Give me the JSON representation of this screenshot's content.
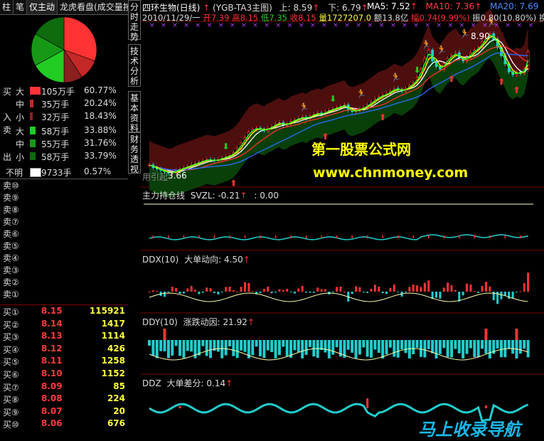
{
  "tabs": [
    {
      "label": "柱",
      "active": false
    },
    {
      "label": "笔",
      "active": false
    },
    {
      "label": "仅主动",
      "active": true
    },
    {
      "label": "龙虎看盘(成交量按",
      "active": false
    }
  ],
  "pie": {
    "slices": [
      {
        "name": "大买",
        "value": 60.77,
        "color": "#ff3333"
      },
      {
        "name": "中买",
        "value": 20.24,
        "color": "#c42828"
      },
      {
        "name": "小买",
        "value": 18.43,
        "color": "#8a2020"
      },
      {
        "name": "大卖",
        "value": 33.88,
        "color": "#22cc22"
      },
      {
        "name": "中卖",
        "value": 31.76,
        "color": "#179917"
      },
      {
        "name": "小卖",
        "value": 33.79,
        "color": "#0e6b0e"
      }
    ]
  },
  "flow": {
    "buy_side": [
      "买",
      "入"
    ],
    "sell_side": [
      "卖",
      "出"
    ],
    "rows": [
      {
        "size": "大",
        "volume": "105万手",
        "pct": "60.77%",
        "bar": 0.6077,
        "color": "#ff3333"
      },
      {
        "size": "中",
        "volume": "35万手",
        "pct": "20.24%",
        "bar": 0.2024,
        "color": "#c42828"
      },
      {
        "size": "小",
        "volume": "32万手",
        "pct": "18.43%",
        "bar": 0.1843,
        "color": "#8a2020"
      },
      {
        "size": "大",
        "volume": "58万手",
        "pct": "33.88%",
        "bar": 0.3388,
        "color": "#22cc22"
      },
      {
        "size": "中",
        "volume": "55万手",
        "pct": "31.76%",
        "bar": 0.3176,
        "color": "#179917"
      },
      {
        "size": "小",
        "volume": "58万手",
        "pct": "33.79%",
        "bar": 0.3379,
        "color": "#0e6b0e"
      }
    ],
    "unknown": {
      "label": "不明",
      "volume": "9733手",
      "pct": "0.57%",
      "bar": 0.0057,
      "color": "#ffffff"
    }
  },
  "orderbook": {
    "sells": [
      "卖⑩",
      "卖⑨",
      "卖⑧",
      "卖⑦",
      "卖⑥",
      "卖⑤",
      "卖④",
      "卖③",
      "卖②",
      "卖①"
    ],
    "buys": [
      {
        "label": "买①",
        "price": "8.15",
        "volume": "115921"
      },
      {
        "label": "买②",
        "price": "8.14",
        "volume": "1417"
      },
      {
        "label": "买③",
        "price": "8.13",
        "volume": "1114"
      },
      {
        "label": "买④",
        "price": "8.12",
        "volume": "426"
      },
      {
        "label": "买⑤",
        "price": "8.11",
        "volume": "1258"
      },
      {
        "label": "买⑥",
        "price": "8.10",
        "volume": "1152"
      },
      {
        "label": "买⑦",
        "price": "8.09",
        "volume": "85"
      },
      {
        "label": "买⑧",
        "price": "8.08",
        "volume": "224"
      },
      {
        "label": "买⑨",
        "price": "8.07",
        "volume": "20"
      },
      {
        "label": "买⑩",
        "price": "8.06",
        "volume": "676"
      }
    ]
  },
  "side_tabs": [
    "分时走势",
    "技术分析",
    "基本资料",
    "财务透视"
  ],
  "header": {
    "stock": "四环生物(日线)",
    "indicator": "(YGB-TA3主图)",
    "up": "上: 8.59",
    "down": "下: 6.79",
    "ma5": "MA5: 7.52",
    "ma10": "MA10: 7.36",
    "ma20": "MA20: 7.69",
    "date": "2010/11/29/一",
    "open": "开7.39",
    "high": "高8.15",
    "low": "低7.35",
    "close": "收8.15",
    "volume": "量1727207.0",
    "amount": "额13.8亿",
    "change": "幅0.74(9.99%)",
    "amplitude": "振0.80(10.80%)",
    "turnover": "换"
  },
  "main_chart": {
    "high_label": "8.90",
    "low_label": "3.66",
    "low_prefix": "用引起",
    "close": [
      4.0,
      3.9,
      3.85,
      3.8,
      3.75,
      3.7,
      3.72,
      3.8,
      3.85,
      3.9,
      3.95,
      4.0,
      4.05,
      4.1,
      4.15,
      4.2,
      4.18,
      4.15,
      4.2,
      4.25,
      4.3,
      4.35,
      4.45,
      4.6,
      4.8,
      5.0,
      5.2,
      5.3,
      5.35,
      5.3,
      5.25,
      5.35,
      5.4,
      5.5,
      5.55,
      5.45,
      5.5,
      5.6,
      5.65,
      5.7,
      5.75,
      5.7,
      5.8,
      5.85,
      5.9,
      5.85,
      5.95,
      6.0,
      6.05,
      6.1,
      6.15,
      6.2,
      6.0,
      5.95,
      6.0,
      6.05,
      6.1,
      6.2,
      6.3,
      6.4,
      6.5,
      6.55,
      6.6,
      6.7,
      6.8,
      6.75,
      6.7,
      6.8,
      6.9,
      7.0,
      7.2,
      7.5,
      7.9,
      8.2,
      7.8,
      7.6,
      7.5,
      7.7,
      7.9,
      8.0,
      8.1,
      7.9,
      7.8,
      7.95,
      8.1,
      8.2,
      8.3,
      8.5,
      8.7,
      8.8,
      8.6,
      8.3,
      8.0,
      7.7,
      7.4,
      7.3,
      7.4,
      7.35,
      7.5,
      8.15
    ]
  },
  "sub_charts": {
    "svzl": {
      "title": "主力持仓线",
      "value": "SVZL: -0.21",
      "extra": ": 0.00"
    },
    "ddx": {
      "title": "DDX(10)",
      "name": "大单动向",
      "value": "4.50"
    },
    "ddy": {
      "title": "DDY(10)",
      "name": "涨跌动因",
      "value": "21.92"
    },
    "ddz": {
      "title": "DDZ",
      "name": "大单差分",
      "value": "0.14"
    }
  },
  "watermarks": {
    "line1": "第一股票公式网",
    "line2": "www.chnmoney.com",
    "line3": "马上收录导航"
  },
  "colors": {
    "up": "#ff3333",
    "down": "#22cccc",
    "grid": "#7a0000",
    "yellow": "#ffff00"
  }
}
